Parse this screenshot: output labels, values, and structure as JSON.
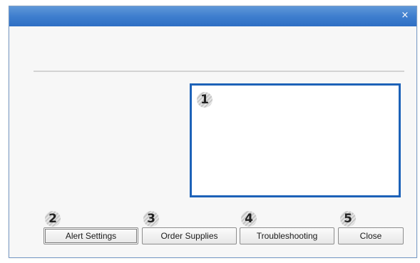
{
  "window": {
    "close_glyph": "×"
  },
  "callouts": {
    "panel": "1",
    "alert_settings": "2",
    "order_supplies": "3",
    "troubleshooting": "4",
    "close": "5"
  },
  "buttons": {
    "alert_settings": "Alert Settings",
    "order_supplies": "Order Supplies",
    "troubleshooting": "Troubleshooting",
    "close": "Close"
  },
  "colors": {
    "titlebar": "#3c7ccd",
    "panel_border": "#1d62b8"
  }
}
